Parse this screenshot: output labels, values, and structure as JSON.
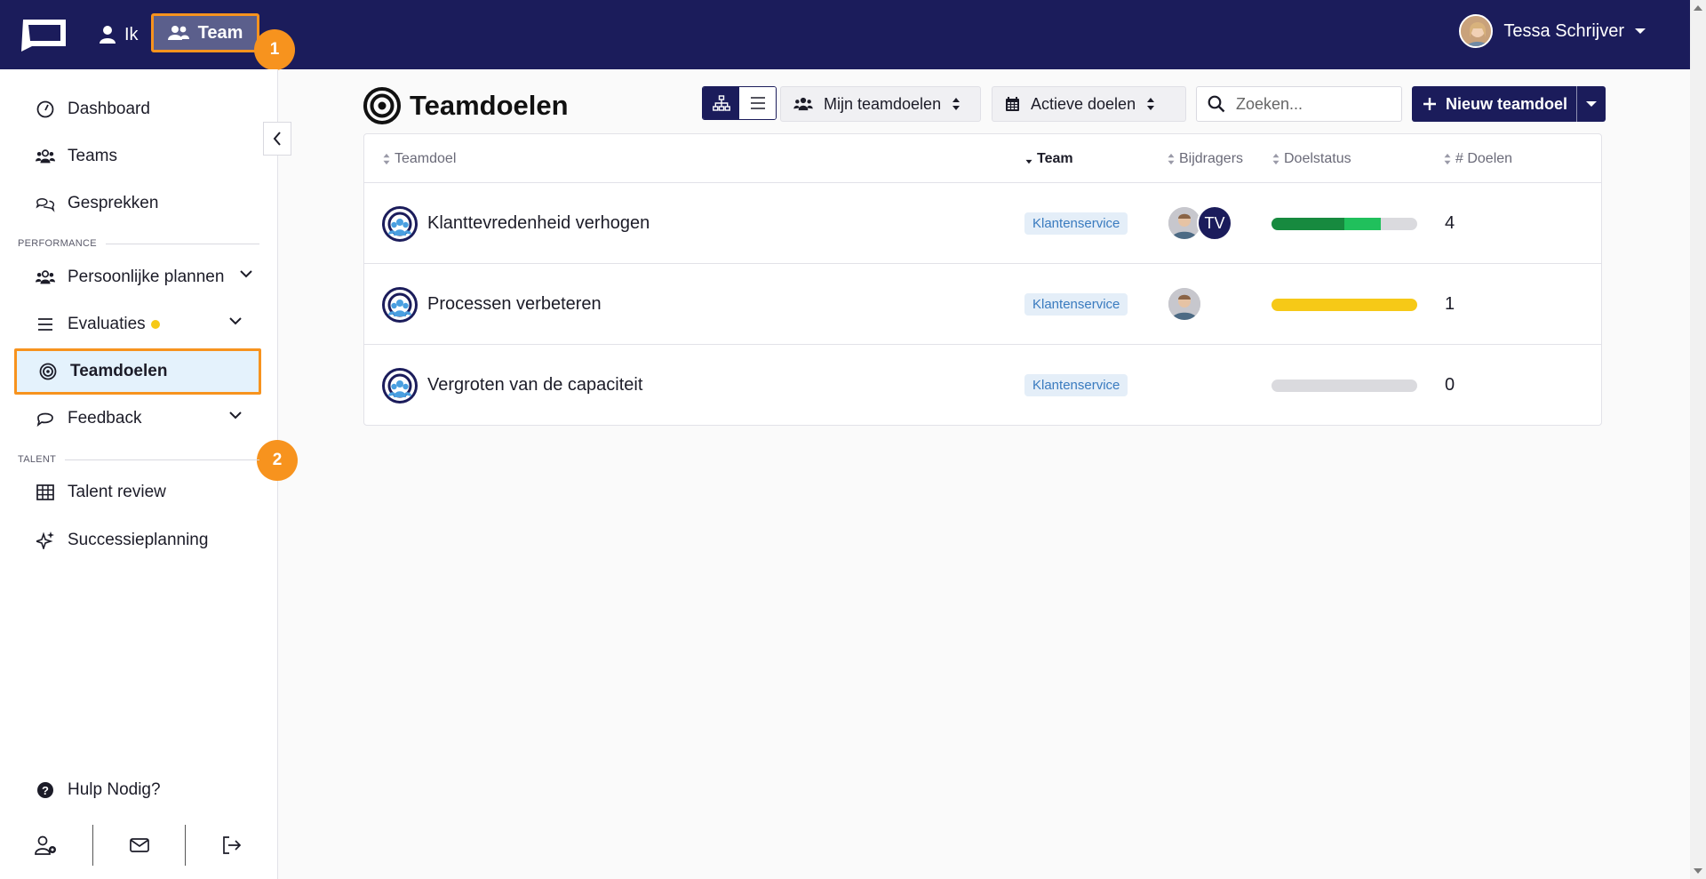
{
  "topbar": {
    "nav_ik": "Ik",
    "nav_team": "Team",
    "user_name": "Tessa Schrijver"
  },
  "annotations": {
    "step1": "1",
    "step2": "2"
  },
  "sidebar": {
    "items": [
      {
        "label": "Dashboard"
      },
      {
        "label": "Teams"
      },
      {
        "label": "Gesprekken"
      },
      {
        "label": "Persoonlijke plannen"
      },
      {
        "label": "Evaluaties"
      },
      {
        "label": "Teamdoelen"
      },
      {
        "label": "Feedback"
      },
      {
        "label": "Talent review"
      },
      {
        "label": "Successieplanning"
      },
      {
        "label": "Hulp Nodig?"
      }
    ],
    "section_performance": "PERFORMANCE",
    "section_talent": "TALENT"
  },
  "main": {
    "title": "Teamdoelen",
    "filter_scope": "Mijn teamdoelen",
    "filter_status": "Actieve doelen",
    "search_placeholder": "Zoeken...",
    "new_button": "Nieuw teamdoel",
    "columns": [
      "Teamdoel",
      "Team",
      "Bijdragers",
      "Doelstatus",
      "# Doelen"
    ],
    "rows": [
      {
        "name": "Klanttevredenheid verhogen",
        "team": "Klantenservice",
        "contributor_initials": "TV",
        "count": "4",
        "status": [
          {
            "fraction": 0.5,
            "color": "#178a3f"
          },
          {
            "fraction": 0.25,
            "color": "#20c05c"
          }
        ]
      },
      {
        "name": "Processen verbeteren",
        "team": "Klantenservice",
        "contributor_initials": "",
        "count": "1",
        "status": [
          {
            "fraction": 1.0,
            "color": "#f6c917"
          }
        ]
      },
      {
        "name": "Vergroten van de capaciteit",
        "team": "Klantenservice",
        "contributor_initials": "",
        "count": "0",
        "status": []
      }
    ]
  },
  "colors": {
    "navy": "#1b1c5b",
    "accent": "#f7931e",
    "tag_bg": "#e4eef8"
  }
}
